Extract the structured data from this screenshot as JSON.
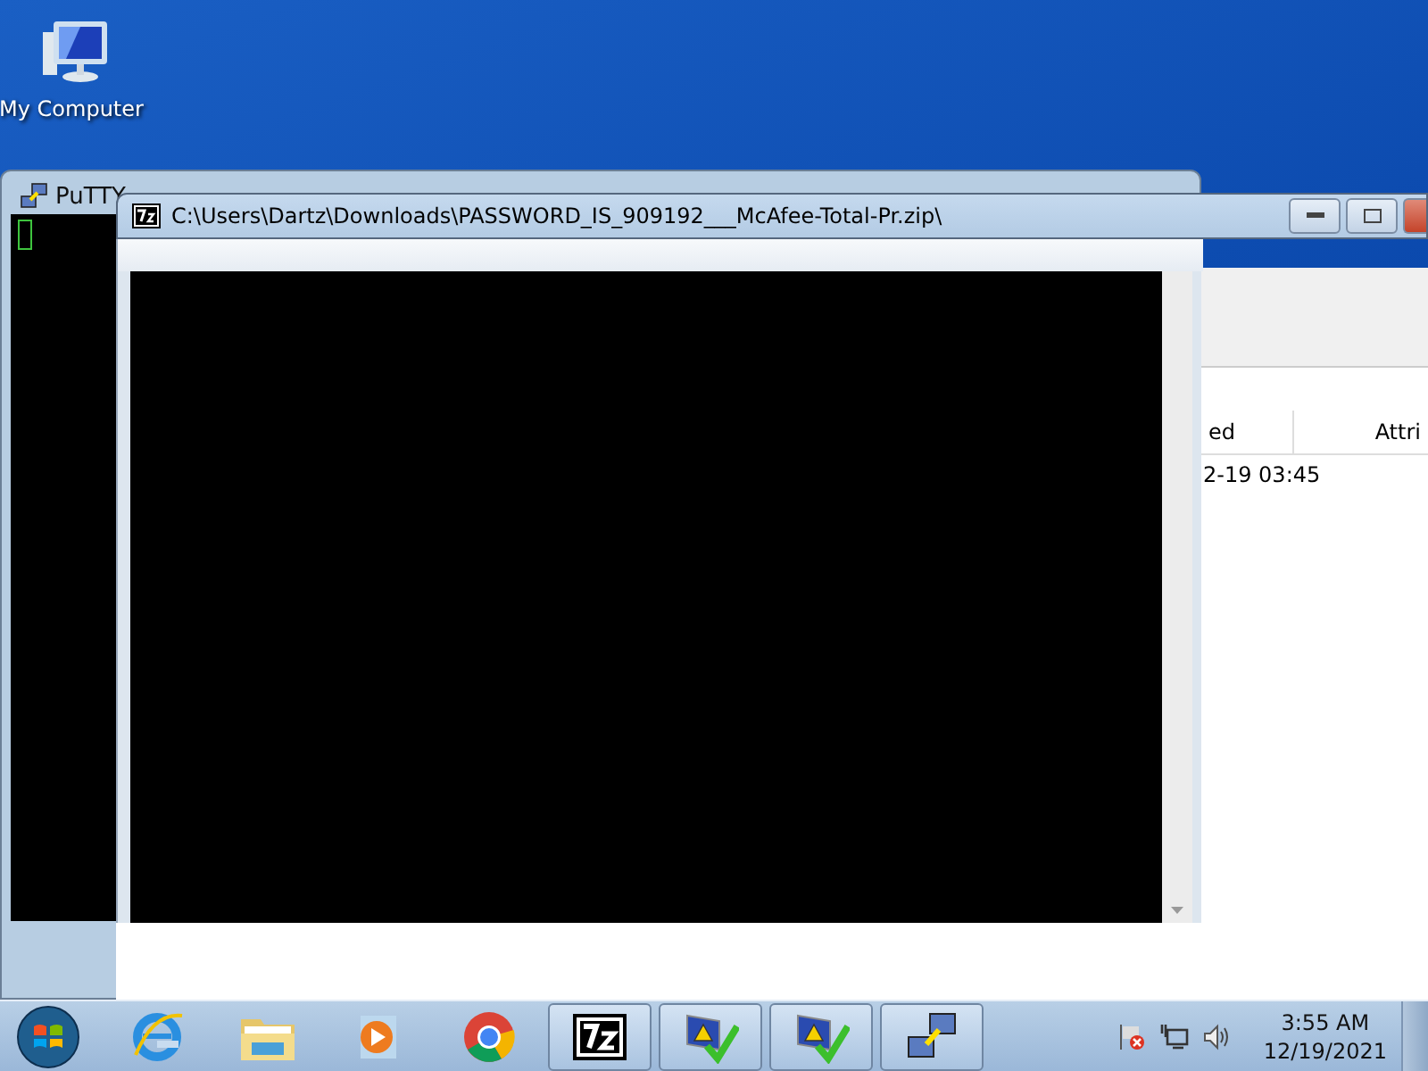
{
  "desktop_icons": [
    {
      "label": "My Computer"
    }
  ],
  "putty_window": {
    "title": "PuTTY"
  },
  "file_manager": {
    "columns": [
      "ed",
      "Attri"
    ],
    "rows": [
      [
        "2-19 03:45"
      ]
    ]
  },
  "console_window": {
    "title": "C:\\Users\\Dartz\\Downloads\\PASSWORD_IS_909192___McAfee-Total-Pr.zip\\"
  },
  "taskbar": {
    "items": [
      {
        "kind": "browser-e",
        "running": false
      },
      {
        "kind": "folder",
        "running": false
      },
      {
        "kind": "media",
        "running": false
      },
      {
        "kind": "chrome",
        "running": false
      },
      {
        "kind": "sevenzip",
        "running": true
      },
      {
        "kind": "warning-check",
        "running": true
      },
      {
        "kind": "warning-check",
        "running": true
      },
      {
        "kind": "network",
        "running": true
      }
    ]
  },
  "clock": {
    "time": "3:55 AM",
    "date": "12/19/2021"
  }
}
